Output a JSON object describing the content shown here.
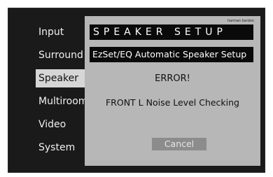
{
  "menu": {
    "items": [
      {
        "label": "Input"
      },
      {
        "label": "Surround"
      },
      {
        "label": "Speaker",
        "selected": true
      },
      {
        "label": "Multiroom"
      },
      {
        "label": "Video"
      },
      {
        "label": "System"
      }
    ]
  },
  "dialog": {
    "brand": "harman kardon",
    "title": "SPEAKER SETUP",
    "subtitle": "EzSet/EQ Automatic Speaker Setup",
    "error_heading": "ERROR!",
    "error_detail": "FRONT L Noise Level Checking",
    "cancel_label": "Cancel"
  },
  "colors": {
    "background": "#1a1a1a",
    "dialog": "#b7b7b7",
    "bar": "#0a0a0a",
    "selected": "#d6d6d6",
    "button": "#8c8c8c"
  }
}
